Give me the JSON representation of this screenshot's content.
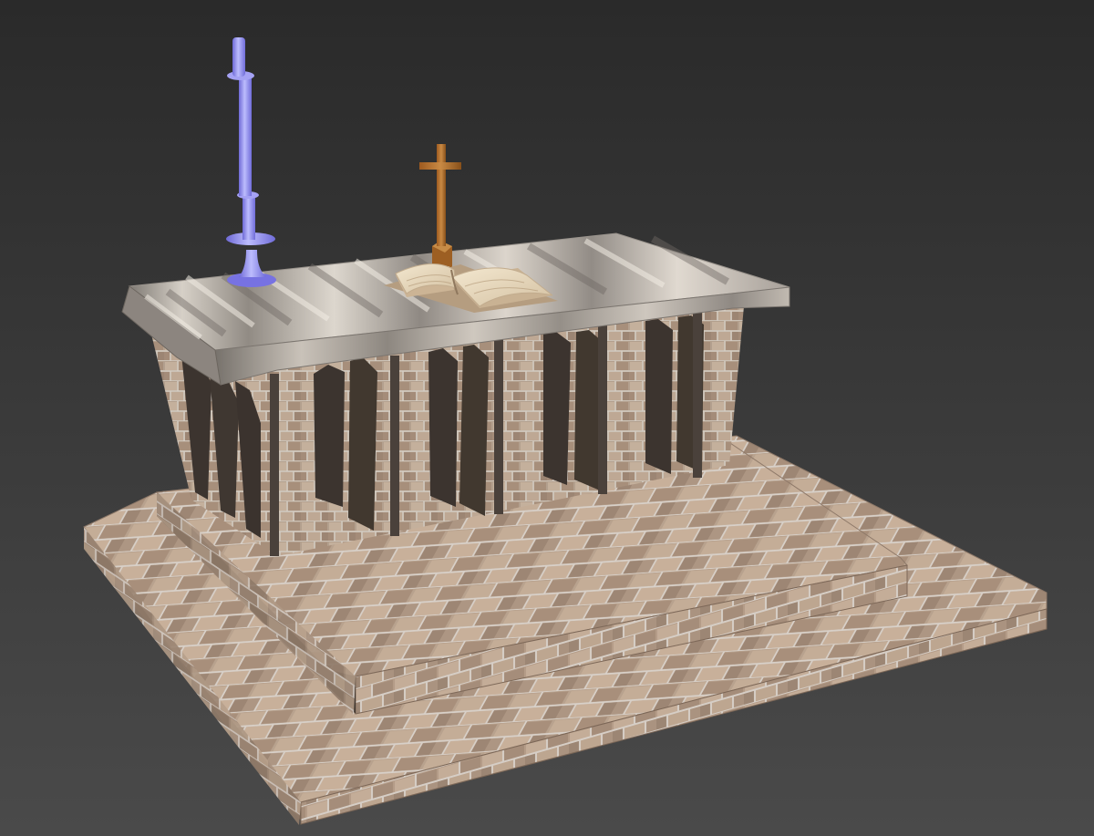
{
  "viewport": {
    "name": "3D viewport",
    "background_top": "#2c2c2c",
    "background_bottom": "#484848"
  },
  "scene": {
    "objects": [
      "stepped-platform",
      "altar-body",
      "altar-cloth",
      "candlestick",
      "cross",
      "open-book"
    ],
    "colors": {
      "brick_base": "#b39d8a",
      "brick_mortar": "#d3cdc6",
      "brick_dark": "#857364",
      "cloth_light": "#d8d3cc",
      "cloth_shadow": "#8f8a84",
      "candlestick": "#8f8cee",
      "candlestick_highlight": "#b7b6fb",
      "cross": "#b4722f",
      "cross_shadow": "#7a4515",
      "book_pages": "#efe0c4",
      "book_edge": "#b79f80"
    }
  }
}
